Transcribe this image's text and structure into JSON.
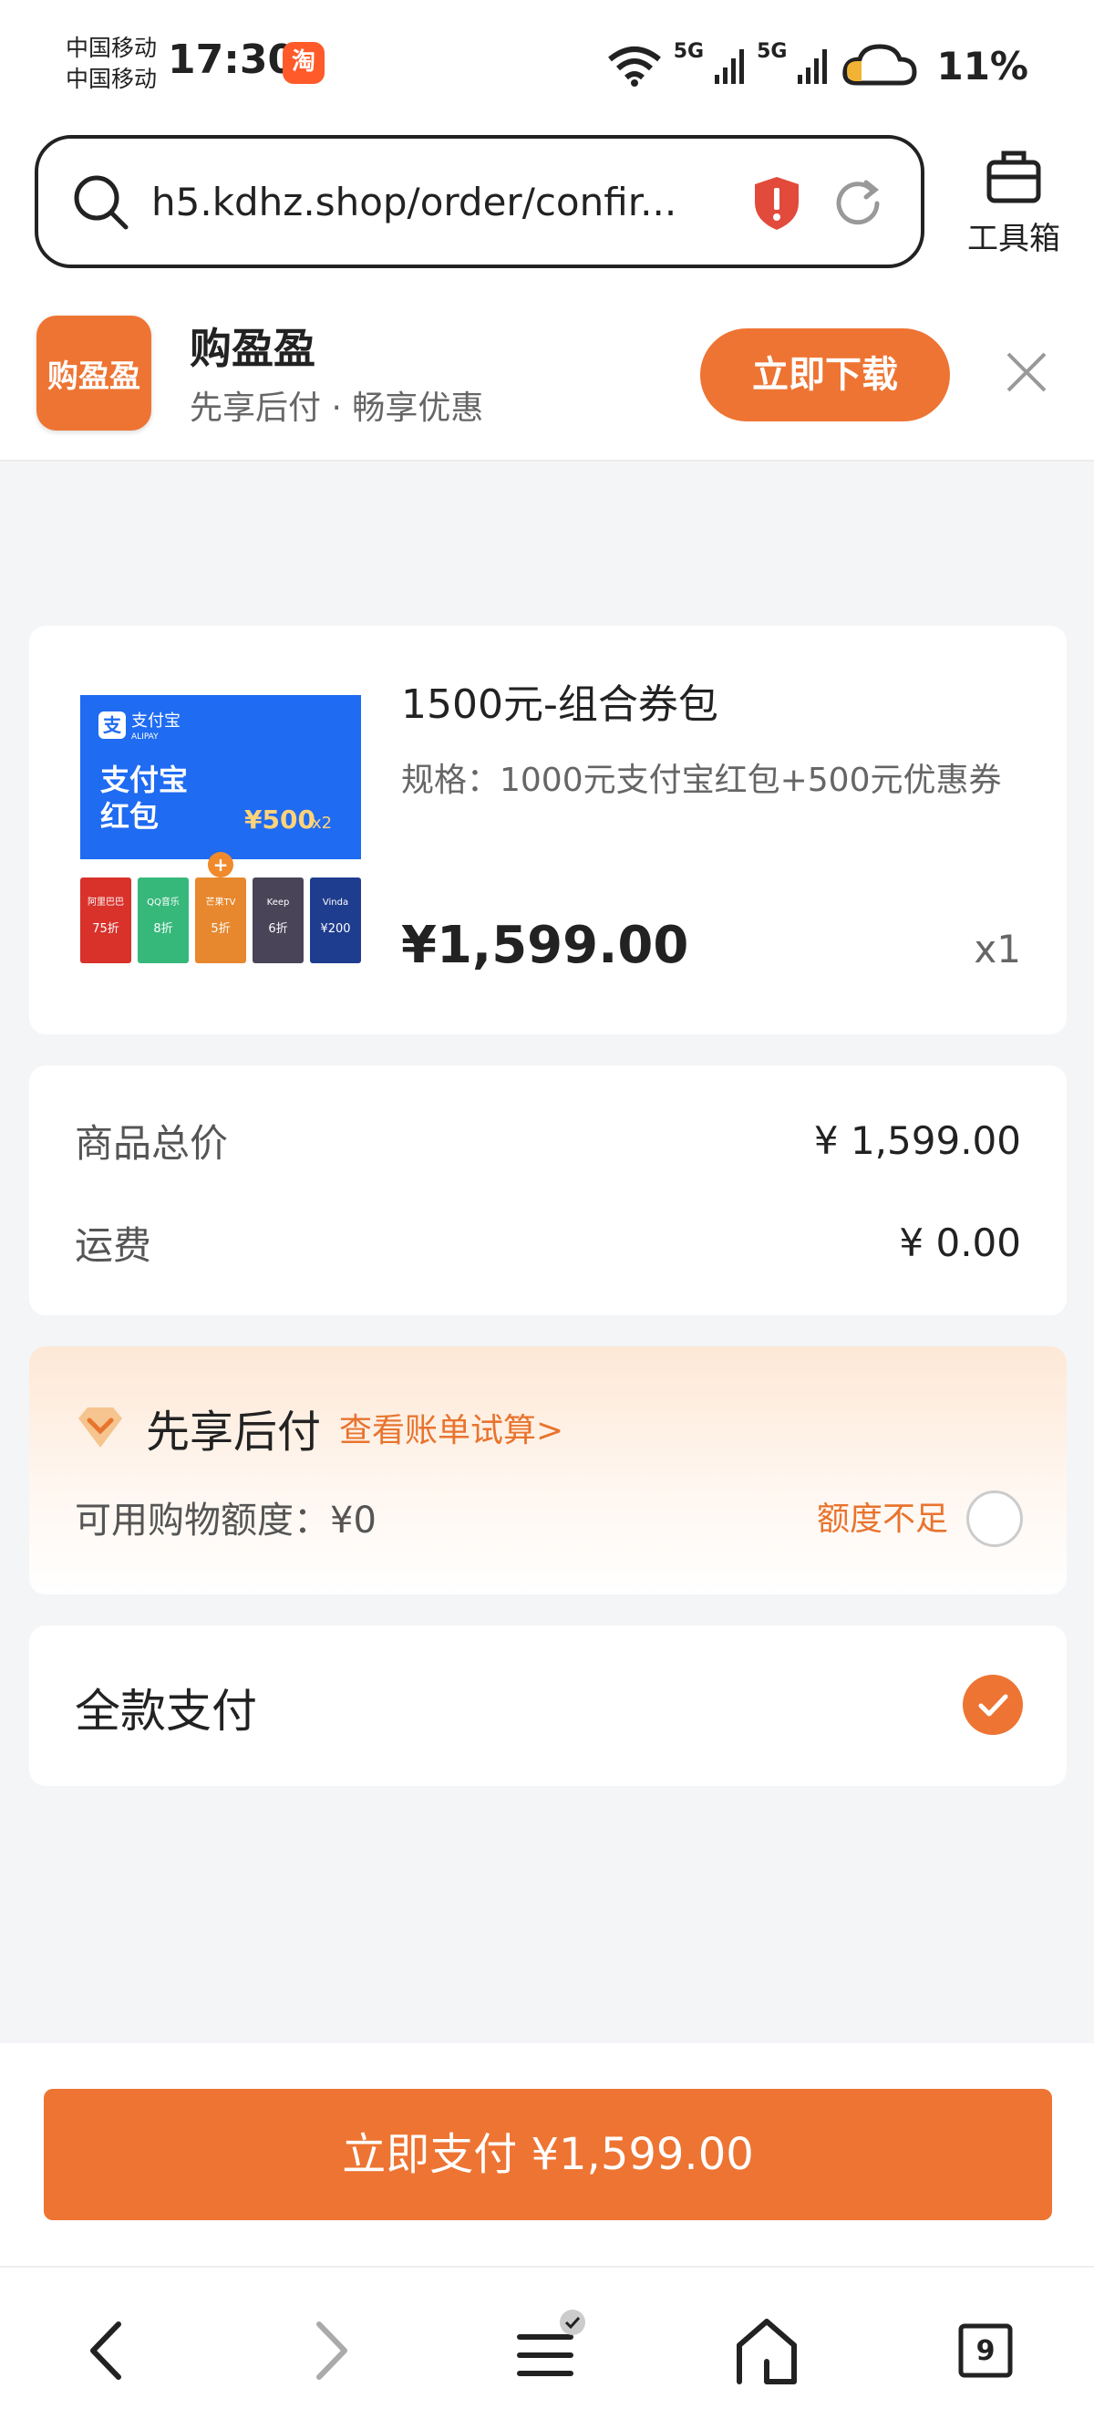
{
  "status_bar": {
    "carrier1": "中国移动",
    "carrier2": "中国移动",
    "time": "17:30",
    "app_badge": "淘",
    "signal1": "5G",
    "signal2": "5G",
    "battery": "11%"
  },
  "address_bar": {
    "url": "h5.kdhz.shop/order/confir...",
    "toolbox_label": "工具箱"
  },
  "app_banner": {
    "logo_text": "购盈盈",
    "name": "购盈盈",
    "slogan": "先享后付 · 畅享优惠",
    "download_label": "立即下载"
  },
  "product": {
    "title": "1500元-组合券包",
    "spec": "规格：1000元支付宝红包+500元优惠券",
    "price": "¥1,599.00",
    "quantity": "x1",
    "image": {
      "brand": "支付宝",
      "brand_en": "ALIPAY",
      "headline_line1": "支付宝",
      "headline_line2": "红包",
      "amount": "¥500",
      "multiplier": "x2",
      "tiles": [
        {
          "name": "阿里巴巴",
          "offer": "75折",
          "color": "#d8322b"
        },
        {
          "name": "QQ音乐",
          "offer": "8折",
          "color": "#37b87b"
        },
        {
          "name": "芒果TV",
          "offer": "5折",
          "color": "#e7882f"
        },
        {
          "name": "Keep",
          "offer": "6折",
          "color": "#4a4458"
        },
        {
          "name": "Vinda",
          "offer": "¥200",
          "color": "#1f3d8f"
        }
      ]
    }
  },
  "totals": {
    "goods_label": "商品总价",
    "goods_value": "¥ 1,599.00",
    "shipping_label": "运费",
    "shipping_value": "¥ 0.00"
  },
  "bnpl": {
    "title": "先享后付",
    "link": "查看账单试算>",
    "credit": "可用购物额度：¥0",
    "insufficient": "额度不足"
  },
  "full_payment": {
    "label": "全款支付"
  },
  "pay_button": {
    "label": "立即支付 ¥1,599.00"
  },
  "browser_nav": {
    "tabs_count": "9"
  },
  "colors": {
    "accent": "#ee7433",
    "accent_text": "#e8742e"
  }
}
